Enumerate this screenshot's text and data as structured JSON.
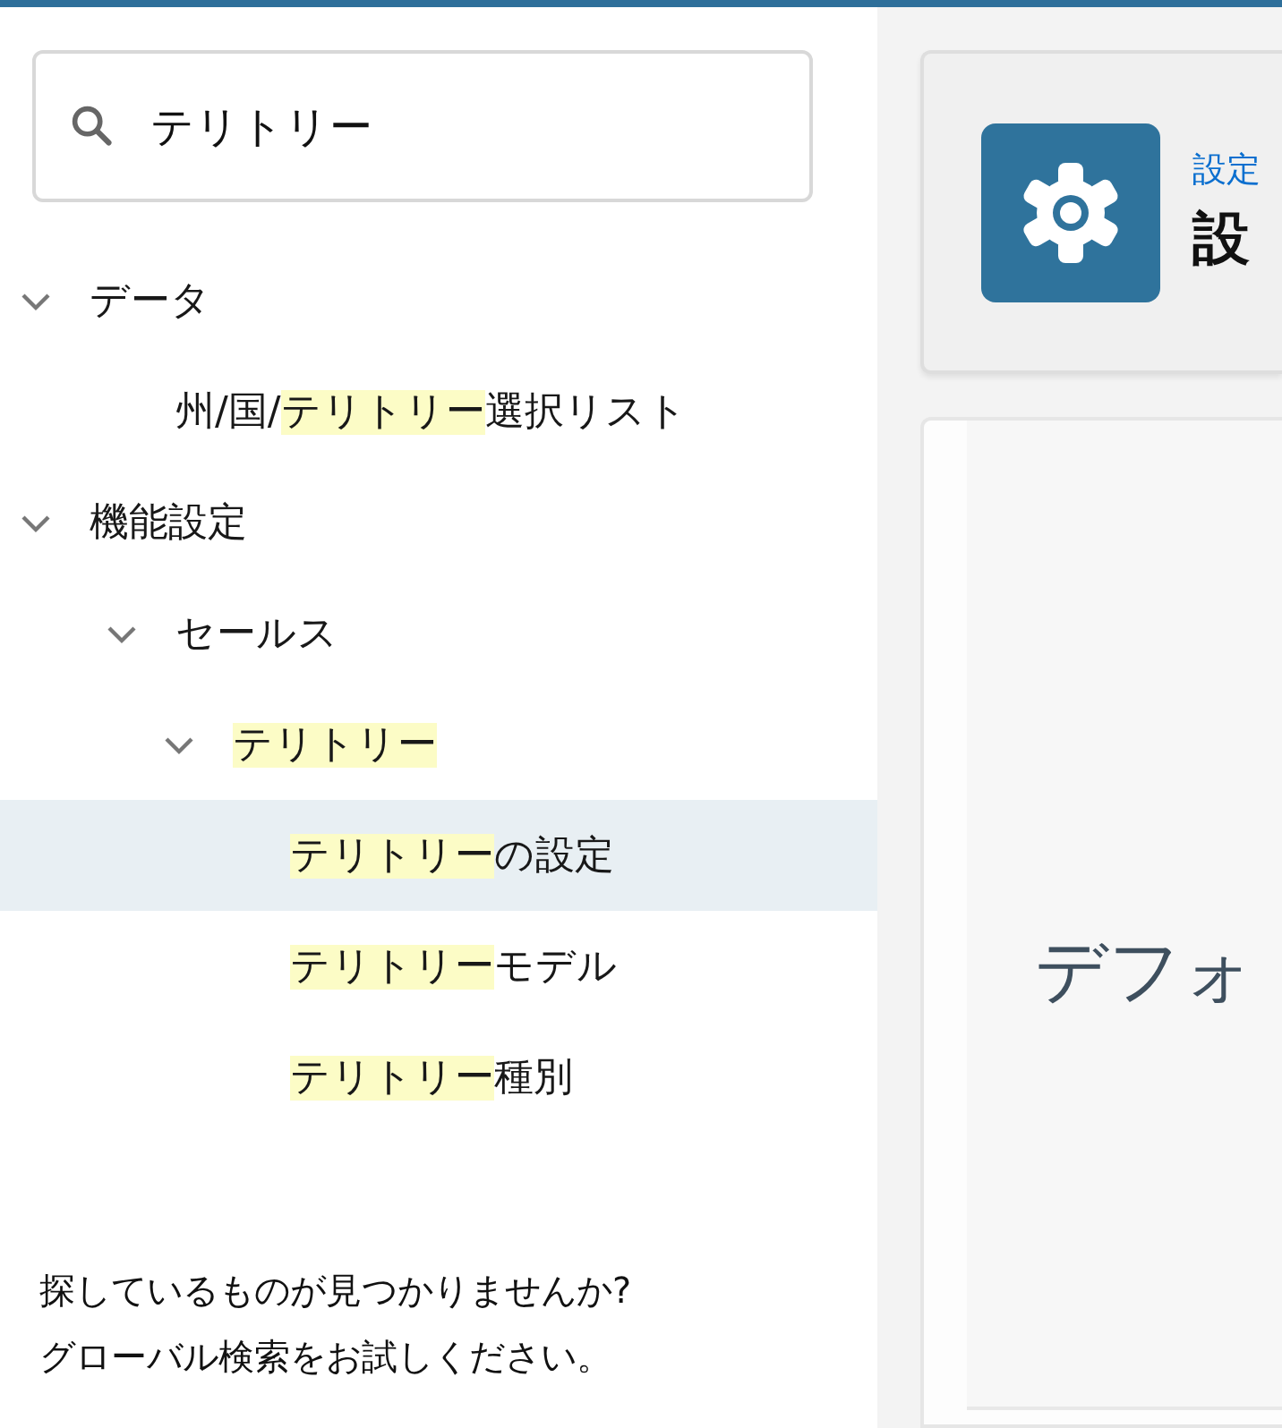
{
  "search": {
    "value": "テリトリー"
  },
  "tree": [
    {
      "parts": [
        {
          "text": "データ",
          "match": false
        }
      ],
      "expanded": true,
      "selected": false,
      "children": [
        {
          "parts": [
            {
              "text": "州/国/",
              "match": false
            },
            {
              "text": "テリトリー",
              "match": true
            },
            {
              "text": "選択リスト",
              "match": false
            }
          ],
          "selected": false
        }
      ]
    },
    {
      "parts": [
        {
          "text": "機能設定",
          "match": false
        }
      ],
      "expanded": true,
      "selected": false,
      "children": [
        {
          "parts": [
            {
              "text": "セールス",
              "match": false
            }
          ],
          "expanded": true,
          "selected": false,
          "children": [
            {
              "parts": [
                {
                  "text": "テリトリー",
                  "match": true
                }
              ],
              "expanded": true,
              "selected": false,
              "children": [
                {
                  "parts": [
                    {
                      "text": "テリトリー",
                      "match": true
                    },
                    {
                      "text": "の設定",
                      "match": false
                    }
                  ],
                  "selected": true
                },
                {
                  "parts": [
                    {
                      "text": "テリトリー",
                      "match": true
                    },
                    {
                      "text": "モデル",
                      "match": false
                    }
                  ],
                  "selected": false
                },
                {
                  "parts": [
                    {
                      "text": "テリトリー",
                      "match": true
                    },
                    {
                      "text": "種別",
                      "match": false
                    }
                  ],
                  "selected": false
                }
              ]
            }
          ]
        }
      ]
    }
  ],
  "hint": [
    "探しているものが見つかりませんか?",
    "グローバル検索をお試しください。"
  ],
  "header": {
    "breadcrumb": "設定",
    "title": "設"
  },
  "panel": {
    "heading": "デフォ"
  }
}
